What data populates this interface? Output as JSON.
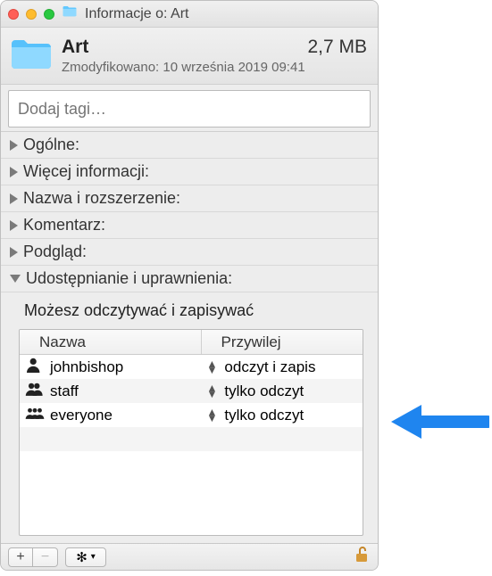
{
  "window": {
    "title": "Informacje o: Art"
  },
  "header": {
    "name": "Art",
    "size": "2,7 MB",
    "modified": "Zmodyfikowano: 10 września 2019 09:41"
  },
  "tags": {
    "placeholder": "Dodaj tagi…",
    "value": ""
  },
  "sections": [
    {
      "label": "Ogólne:",
      "expanded": false
    },
    {
      "label": "Więcej informacji:",
      "expanded": false
    },
    {
      "label": "Nazwa i rozszerzenie:",
      "expanded": false
    },
    {
      "label": "Komentarz:",
      "expanded": false
    },
    {
      "label": "Podgląd:",
      "expanded": false
    },
    {
      "label": "Udostępnianie i uprawnienia:",
      "expanded": true
    }
  ],
  "sharing": {
    "message": "Możesz odczytywać i zapisywać",
    "columns": {
      "name": "Nazwa",
      "privilege": "Przywilej"
    },
    "rows": [
      {
        "icon": "person",
        "name": "johnbishop",
        "privilege": "odczyt i zapis"
      },
      {
        "icon": "people",
        "name": "staff",
        "privilege": "tylko odczyt"
      },
      {
        "icon": "group",
        "name": "everyone",
        "privilege": "tylko odczyt"
      }
    ]
  },
  "footer": {
    "add_label": "+",
    "remove_label": "−",
    "gear_icon": "gear",
    "lock_icon": "unlocked-lock"
  }
}
